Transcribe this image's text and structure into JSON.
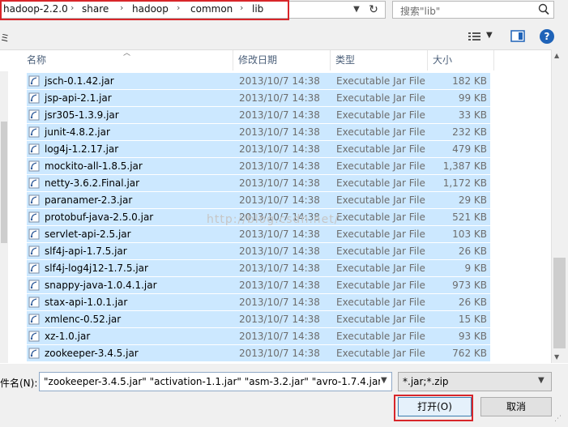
{
  "address": {
    "crumbs": [
      "hadoop-2.2.0",
      "share",
      "hadoop",
      "common",
      "lib"
    ]
  },
  "search": {
    "placeholder": "搜索\"lib\""
  },
  "toolbar": {
    "left_fragment": "ミ"
  },
  "columns": {
    "name": "名称",
    "date": "修改日期",
    "type": "类型",
    "size": "大小"
  },
  "files": [
    {
      "name": "jsch-0.1.42.jar",
      "date": "2013/10/7 14:38",
      "type": "Executable Jar File",
      "size": "182 KB"
    },
    {
      "name": "jsp-api-2.1.jar",
      "date": "2013/10/7 14:38",
      "type": "Executable Jar File",
      "size": "99 KB"
    },
    {
      "name": "jsr305-1.3.9.jar",
      "date": "2013/10/7 14:38",
      "type": "Executable Jar File",
      "size": "33 KB"
    },
    {
      "name": "junit-4.8.2.jar",
      "date": "2013/10/7 14:38",
      "type": "Executable Jar File",
      "size": "232 KB"
    },
    {
      "name": "log4j-1.2.17.jar",
      "date": "2013/10/7 14:38",
      "type": "Executable Jar File",
      "size": "479 KB"
    },
    {
      "name": "mockito-all-1.8.5.jar",
      "date": "2013/10/7 14:38",
      "type": "Executable Jar File",
      "size": "1,387 KB"
    },
    {
      "name": "netty-3.6.2.Final.jar",
      "date": "2013/10/7 14:38",
      "type": "Executable Jar File",
      "size": "1,172 KB"
    },
    {
      "name": "paranamer-2.3.jar",
      "date": "2013/10/7 14:38",
      "type": "Executable Jar File",
      "size": "29 KB"
    },
    {
      "name": "protobuf-java-2.5.0.jar",
      "date": "2013/10/7 14:38",
      "type": "Executable Jar File",
      "size": "521 KB"
    },
    {
      "name": "servlet-api-2.5.jar",
      "date": "2013/10/7 14:38",
      "type": "Executable Jar File",
      "size": "103 KB"
    },
    {
      "name": "slf4j-api-1.7.5.jar",
      "date": "2013/10/7 14:38",
      "type": "Executable Jar File",
      "size": "26 KB"
    },
    {
      "name": "slf4j-log4j12-1.7.5.jar",
      "date": "2013/10/7 14:38",
      "type": "Executable Jar File",
      "size": "9 KB"
    },
    {
      "name": "snappy-java-1.0.4.1.jar",
      "date": "2013/10/7 14:38",
      "type": "Executable Jar File",
      "size": "973 KB"
    },
    {
      "name": "stax-api-1.0.1.jar",
      "date": "2013/10/7 14:38",
      "type": "Executable Jar File",
      "size": "26 KB"
    },
    {
      "name": "xmlenc-0.52.jar",
      "date": "2013/10/7 14:38",
      "type": "Executable Jar File",
      "size": "15 KB"
    },
    {
      "name": "xz-1.0.jar",
      "date": "2013/10/7 14:38",
      "type": "Executable Jar File",
      "size": "93 KB"
    },
    {
      "name": "zookeeper-3.4.5.jar",
      "date": "2013/10/7 14:38",
      "type": "Executable Jar File",
      "size": "762 KB"
    }
  ],
  "watermark": "http://blog.csdn.net/",
  "filename": {
    "label": "件名(N):",
    "value": "\"zookeeper-3.4.5.jar\" \"activation-1.1.jar\" \"asm-3.2.jar\" \"avro-1.7.4.jar\" \""
  },
  "filter": {
    "value": "*.jar;*.zip"
  },
  "buttons": {
    "open": "打开(O)",
    "cancel": "取消"
  },
  "colors": {
    "selection": "#cce8ff",
    "highlight_box": "#d8262a",
    "accent": "#1f63b8"
  }
}
